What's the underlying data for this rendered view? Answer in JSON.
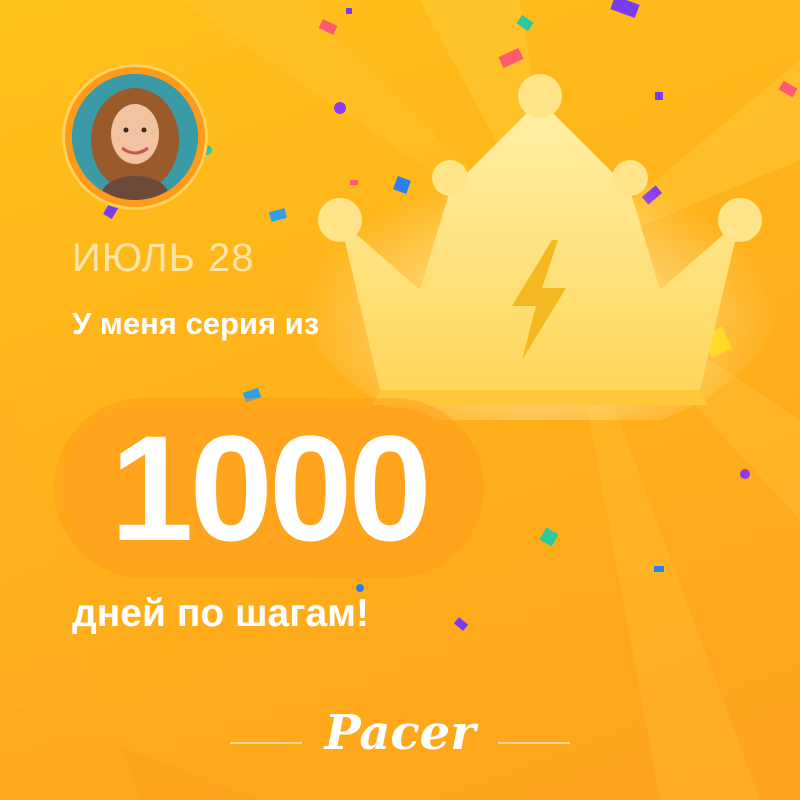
{
  "card": {
    "date": "ИЮЛЬ 28",
    "headline": "У меня серия из",
    "streak_number": "1000",
    "subline": "дней по шагам!",
    "brand": "Pacer"
  },
  "icons": {
    "avatar": "user-avatar-photo",
    "crown": "crown-icon",
    "bolt": "lightning-bolt-icon"
  },
  "colors": {
    "background": "#ffb21a",
    "accent": "#ff9a1a",
    "crown": "#ffe07a",
    "text": "#ffffff"
  }
}
